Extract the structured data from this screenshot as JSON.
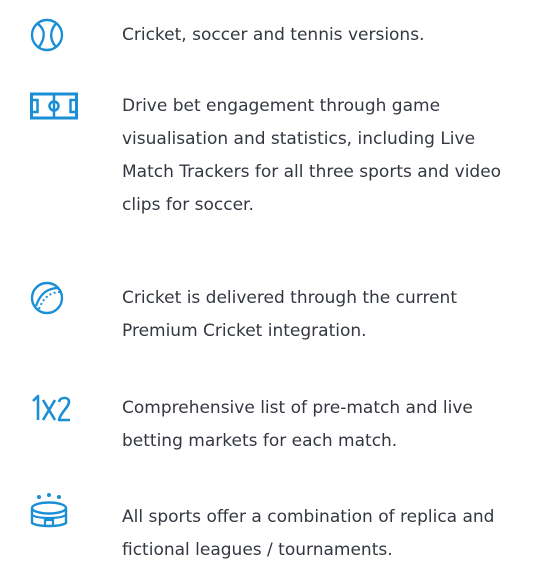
{
  "accent_color": "#1a8fd6",
  "text_color": "#333740",
  "features": [
    {
      "icon": "tennis-ball-icon",
      "text": "Cricket, soccer and tennis versions."
    },
    {
      "icon": "soccer-pitch-icon",
      "text": "Drive bet engagement through game visualisation and statistics, including Live Match Trackers for all three sports and video clips for soccer."
    },
    {
      "icon": "cricket-ball-icon",
      "text": "Cricket is delivered through the current Premium Cricket integration."
    },
    {
      "icon": "1x2-odds-icon",
      "text": "Comprehensive list of pre-match and live betting markets for each match."
    },
    {
      "icon": "stadium-icon",
      "text": "All sports offer a combination of replica and fictional leagues / tournaments."
    }
  ]
}
